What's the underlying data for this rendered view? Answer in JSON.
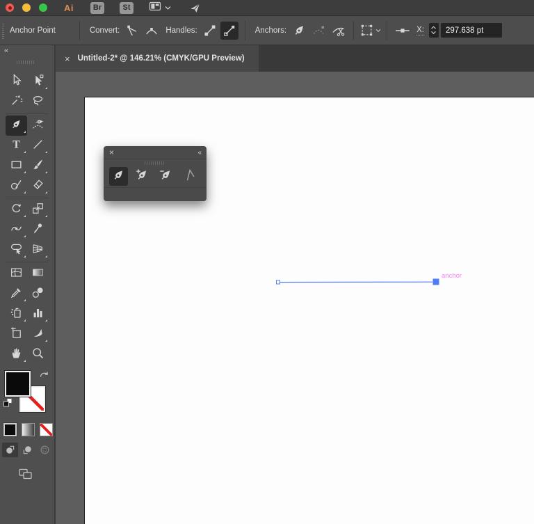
{
  "titlebar": {
    "app_logo": "Ai",
    "bridge": "Br",
    "stock": "St"
  },
  "control_bar": {
    "title": "Anchor Point",
    "convert_label": "Convert:",
    "handles_label": "Handles:",
    "anchors_label": "Anchors:",
    "x_label": "X:",
    "x_value": "297.638 pt"
  },
  "tab": {
    "close": "×",
    "title": "Untitled-2* @ 146.21% (CMYK/GPU Preview)"
  },
  "toolbar": {
    "collapse": "«",
    "tools": [
      {
        "name": "selection",
        "flyout": false,
        "selected": false
      },
      {
        "name": "direct-selection",
        "flyout": true,
        "selected": false
      },
      {
        "name": "magic-wand",
        "flyout": false,
        "selected": false
      },
      {
        "name": "lasso",
        "flyout": false,
        "selected": false
      },
      {
        "name": "pen",
        "flyout": true,
        "selected": true
      },
      {
        "name": "curvature",
        "flyout": false,
        "selected": false
      },
      {
        "name": "type",
        "flyout": true,
        "selected": false
      },
      {
        "name": "line-segment",
        "flyout": true,
        "selected": false
      },
      {
        "name": "rectangle",
        "flyout": true,
        "selected": false
      },
      {
        "name": "paintbrush",
        "flyout": true,
        "selected": false
      },
      {
        "name": "shaper",
        "flyout": true,
        "selected": false
      },
      {
        "name": "eraser",
        "flyout": true,
        "selected": false
      },
      {
        "name": "rotate",
        "flyout": true,
        "selected": false
      },
      {
        "name": "scale",
        "flyout": true,
        "selected": false
      },
      {
        "name": "width",
        "flyout": true,
        "selected": false
      },
      {
        "name": "puppet-warp",
        "flyout": false,
        "selected": false
      },
      {
        "name": "shape-builder",
        "flyout": true,
        "selected": false
      },
      {
        "name": "perspective-grid",
        "flyout": true,
        "selected": false
      },
      {
        "name": "mesh",
        "flyout": false,
        "selected": false
      },
      {
        "name": "gradient",
        "flyout": false,
        "selected": false
      },
      {
        "name": "eyedropper",
        "flyout": true,
        "selected": false
      },
      {
        "name": "blend",
        "flyout": false,
        "selected": false
      },
      {
        "name": "symbol-sprayer",
        "flyout": true,
        "selected": false
      },
      {
        "name": "column-graph",
        "flyout": true,
        "selected": false
      },
      {
        "name": "artboard",
        "flyout": false,
        "selected": false
      },
      {
        "name": "slice",
        "flyout": true,
        "selected": false
      },
      {
        "name": "hand",
        "flyout": true,
        "selected": false
      },
      {
        "name": "zoom",
        "flyout": false,
        "selected": false
      }
    ],
    "separators_after": [
      "lasso",
      "eraser",
      "perspective-grid"
    ]
  },
  "pen_panel": {
    "close": "×",
    "collapse": "«",
    "tools": [
      {
        "name": "pen",
        "selected": true
      },
      {
        "name": "add-anchor-point",
        "selected": false
      },
      {
        "name": "delete-anchor-point",
        "selected": false
      },
      {
        "name": "anchor-point",
        "selected": false
      }
    ]
  },
  "canvas": {
    "annotation": "anchor",
    "path_color": "#4e7cf6",
    "annotation_color": "#fb7cf8"
  },
  "colors": {
    "fill": "#0a0a0a",
    "stroke": "none",
    "none_slash": "#e3201b"
  }
}
